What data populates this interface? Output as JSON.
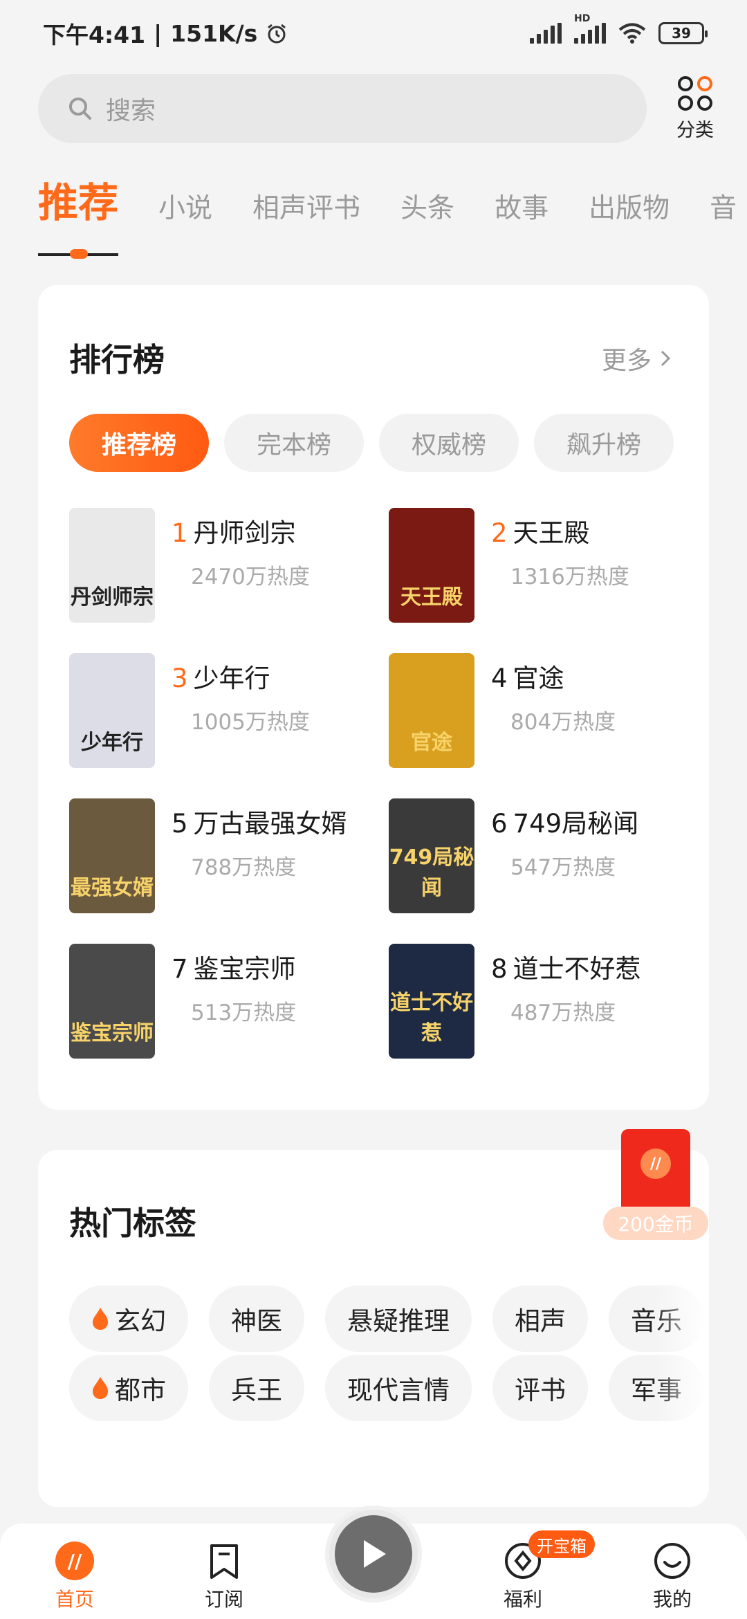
{
  "status_bar": {
    "time": "下午4:41",
    "speed": "151K/s",
    "network_label": "HD",
    "battery": "39"
  },
  "search": {
    "placeholder": "搜索"
  },
  "category_button": {
    "label": "分类"
  },
  "top_tabs": [
    "推荐",
    "小说",
    "相声评书",
    "头条",
    "故事",
    "出版物",
    "音"
  ],
  "ranking": {
    "title": "排行榜",
    "more": "更多",
    "chips": [
      "推荐榜",
      "完本榜",
      "权威榜",
      "飙升榜"
    ],
    "items": [
      {
        "rank": "1",
        "name": "丹师剑宗",
        "heat": "2470万热度",
        "cover_text": "丹剑师宗",
        "cover_color": "#e9e9e9"
      },
      {
        "rank": "2",
        "name": "天王殿",
        "heat": "1316万热度",
        "cover_text": "天王殿",
        "cover_color": "#7a1a12"
      },
      {
        "rank": "3",
        "name": "少年行",
        "heat": "1005万热度",
        "cover_text": "少年行",
        "cover_color": "#dcdde6"
      },
      {
        "rank": "4",
        "name": "官途",
        "heat": "804万热度",
        "cover_text": "官途",
        "cover_color": "#d9a020"
      },
      {
        "rank": "5",
        "name": "万古最强女婿",
        "heat": "788万热度",
        "cover_text": "最强女婿",
        "cover_color": "#6b5a3e"
      },
      {
        "rank": "6",
        "name": "749局秘闻",
        "heat": "547万热度",
        "cover_text": "749局秘闻",
        "cover_color": "#3a3a3a"
      },
      {
        "rank": "7",
        "name": "鉴宝宗师",
        "heat": "513万热度",
        "cover_text": "鉴宝宗师",
        "cover_color": "#4a4a4a"
      },
      {
        "rank": "8",
        "name": "道士不好惹",
        "heat": "487万热度",
        "cover_text": "道士不好惹",
        "cover_color": "#1e2a44"
      }
    ]
  },
  "hot_tags": {
    "title": "热门标签",
    "row1": [
      "玄幻",
      "神医",
      "悬疑推理",
      "相声",
      "音乐"
    ],
    "row2": [
      "都市",
      "兵王",
      "现代言情",
      "评书",
      "军事"
    ]
  },
  "red_packet": {
    "label": "200金币"
  },
  "bottom_nav": {
    "home": "首页",
    "subscribe": "订阅",
    "welfare": "福利",
    "welfare_badge": "开宝箱",
    "mine": "我的"
  },
  "colors": {
    "accent": "#ff6a1a",
    "background": "#f4f4f4"
  }
}
